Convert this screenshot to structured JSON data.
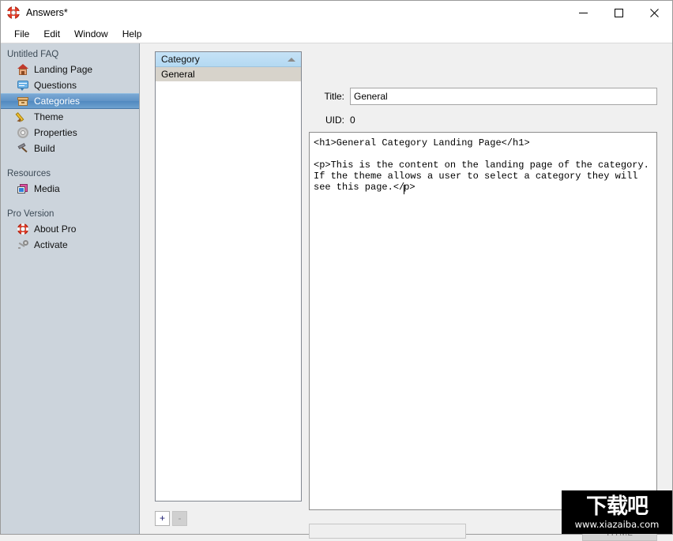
{
  "window": {
    "title": "Answers*",
    "app_icon": "lifebuoy-icon",
    "controls": {
      "minimize": "minimize-icon",
      "maximize": "maximize-icon",
      "close": "close-icon"
    }
  },
  "menubar": {
    "items": [
      {
        "label": "File"
      },
      {
        "label": "Edit"
      },
      {
        "label": "Window"
      },
      {
        "label": "Help"
      }
    ]
  },
  "sidebar": {
    "groups": [
      {
        "title": "Untitled FAQ",
        "items": [
          {
            "label": "Landing Page",
            "icon": "house-icon",
            "selected": false
          },
          {
            "label": "Questions",
            "icon": "speech-bubble-icon",
            "selected": false
          },
          {
            "label": "Categories",
            "icon": "box-icon",
            "selected": true
          },
          {
            "label": "Theme",
            "icon": "pencil-icon",
            "selected": false
          },
          {
            "label": "Properties",
            "icon": "gear-icon",
            "selected": false
          },
          {
            "label": "Build",
            "icon": "hammer-icon",
            "selected": false
          }
        ]
      },
      {
        "title": "Resources",
        "items": [
          {
            "label": "Media",
            "icon": "media-icon",
            "selected": false
          }
        ]
      },
      {
        "title": "Pro Version",
        "items": [
          {
            "label": "About Pro",
            "icon": "lifebuoy-icon",
            "selected": false
          },
          {
            "label": "Activate",
            "icon": "key-icon",
            "selected": false
          }
        ]
      }
    ],
    "selected_color": "#5f93c6",
    "background_color": "#ccd4dc"
  },
  "category_list": {
    "column_header": "Category",
    "sort_indicator": "sort-ascending-icon",
    "header_color": "#b9dcf3",
    "selected_row_color": "#d7d3cb",
    "rows": [
      {
        "label": "General",
        "selected": true
      }
    ],
    "add_button_label": "+",
    "remove_button_label": "-"
  },
  "editor": {
    "title_label": "Title:",
    "title_value": "General",
    "title_placeholder": "",
    "uid_label": "UID:",
    "uid_value": "0",
    "content_before_caret": "<h1>General Category Landing Page</h1>\n\n<p>This is the content on the landing page of the category. If the theme allows a user to select a category they will see this page.</",
    "content_after_caret": "p>",
    "status_field_value": "",
    "status_field_placeholder": "",
    "html_button_label": "HTML"
  },
  "watermark": {
    "text": "下载吧",
    "url": "www.xiazaiba.com"
  }
}
